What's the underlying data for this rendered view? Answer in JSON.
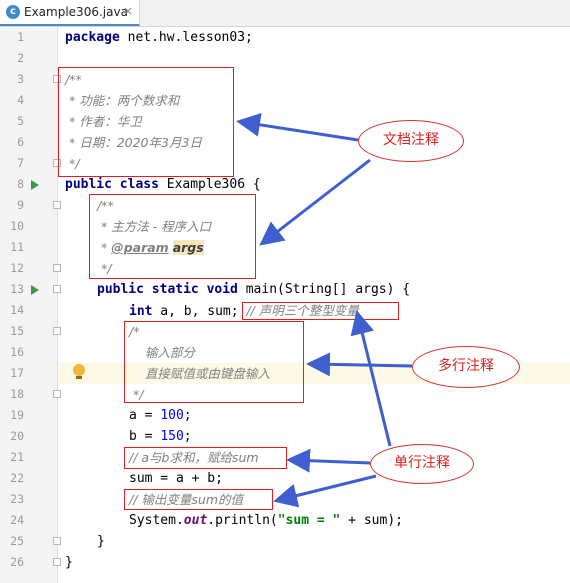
{
  "tab": {
    "icon": "c",
    "title": "Example306.java",
    "close": "×"
  },
  "line_numbers": [
    "1",
    "2",
    "3",
    "4",
    "5",
    "6",
    "7",
    "8",
    "9",
    "10",
    "11",
    "12",
    "13",
    "14",
    "15",
    "16",
    "17",
    "18",
    "19",
    "20",
    "21",
    "22",
    "23",
    "24",
    "25",
    "26"
  ],
  "code": {
    "l1_kw": "package",
    "l1_rest": " net.hw.lesson03;",
    "l3": "/**",
    "l4": " * 功能：两个数求和",
    "l5": " * 作者：华卫",
    "l6": " * 日期：2020年3月3日",
    "l7": " */",
    "l8_kw": "public class",
    "l8_rest": " Example306 {",
    "l9": "/**",
    "l10": " * 主方法 - 程序入口",
    "l11_star": " * ",
    "l11_tag": "@param",
    "l11_sp": " ",
    "l11_param": "args",
    "l12": " */",
    "l13_kw": "public static void",
    "l13_rest": " main(String[] args) {",
    "l14_kw": "int",
    "l14_rest": " a, b, sum; ",
    "l14_comment": "// 声明三个整型变量",
    "l15": "/*",
    "l16": "    输入部分",
    "l17": "    直接赋值或由键盘输入",
    "l18": " */",
    "l19_a": "a = ",
    "l19_num": "100",
    "l19_end": ";",
    "l20_a": "b = ",
    "l20_num": "150",
    "l20_end": ";",
    "l21": "// a与b求和，赋给sum",
    "l22": "sum = a + b;",
    "l23": "// 输出变量sum的值",
    "l24_a": "System.",
    "l24_field": "out",
    "l24_b": ".println(",
    "l24_str": "\"sum = \"",
    "l24_c": " + sum);",
    "l25": "}",
    "l26": "}"
  },
  "annotations": {
    "doc_comment": "文档注释",
    "multi_line_comment": "多行注释",
    "single_line_comment": "单行注释"
  },
  "colors": {
    "keyword": "#000080",
    "comment": "#808080",
    "number": "#0000ff",
    "string": "#008000",
    "annotation_box": "#e02020",
    "arrow": "#3f5fd0",
    "run_icon": "#3c9a46"
  },
  "icons": [
    "java-class-icon",
    "close-icon",
    "run-gutter-icon",
    "fold-marker-icon",
    "lightbulb-icon",
    "arrow-icon"
  ]
}
